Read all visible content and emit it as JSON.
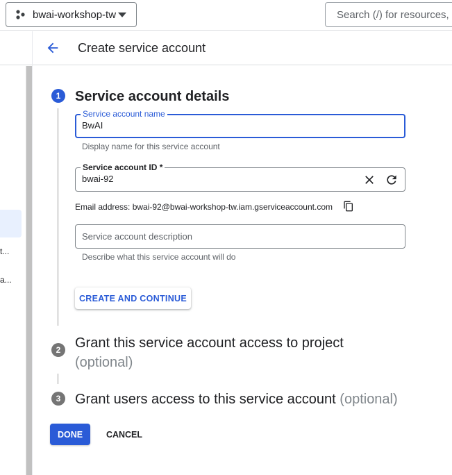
{
  "topbar": {
    "project_name": "bwai-workshop-tw",
    "search_placeholder": "Search (/) for resources, docs, products, and more"
  },
  "leftnav": {
    "items": [
      "t...",
      "a..."
    ]
  },
  "header": {
    "title": "Create service account"
  },
  "steps": [
    {
      "number": "1",
      "title": "Service account details",
      "optional": ""
    },
    {
      "number": "2",
      "title": "Grant this service account access to project",
      "optional": "(optional)"
    },
    {
      "number": "3",
      "title": "Grant users access to this service account",
      "optional": "(optional)"
    }
  ],
  "form": {
    "name": {
      "label": "Service account name",
      "value": "BwAI",
      "hint": "Display name for this service account"
    },
    "id": {
      "label": "Service account ID *",
      "value": "bwai-92"
    },
    "email_line": "Email address: bwai-92@bwai-workshop-tw.iam.gserviceaccount.com",
    "description": {
      "placeholder": "Service account description",
      "value": "",
      "hint": "Describe what this service account will do"
    },
    "continue_label": "CREATE AND CONTINUE"
  },
  "actions": {
    "done_label": "DONE",
    "cancel_label": "CANCEL"
  },
  "colors": {
    "accent": "#2a5bd7",
    "step_inactive": "#757575"
  }
}
